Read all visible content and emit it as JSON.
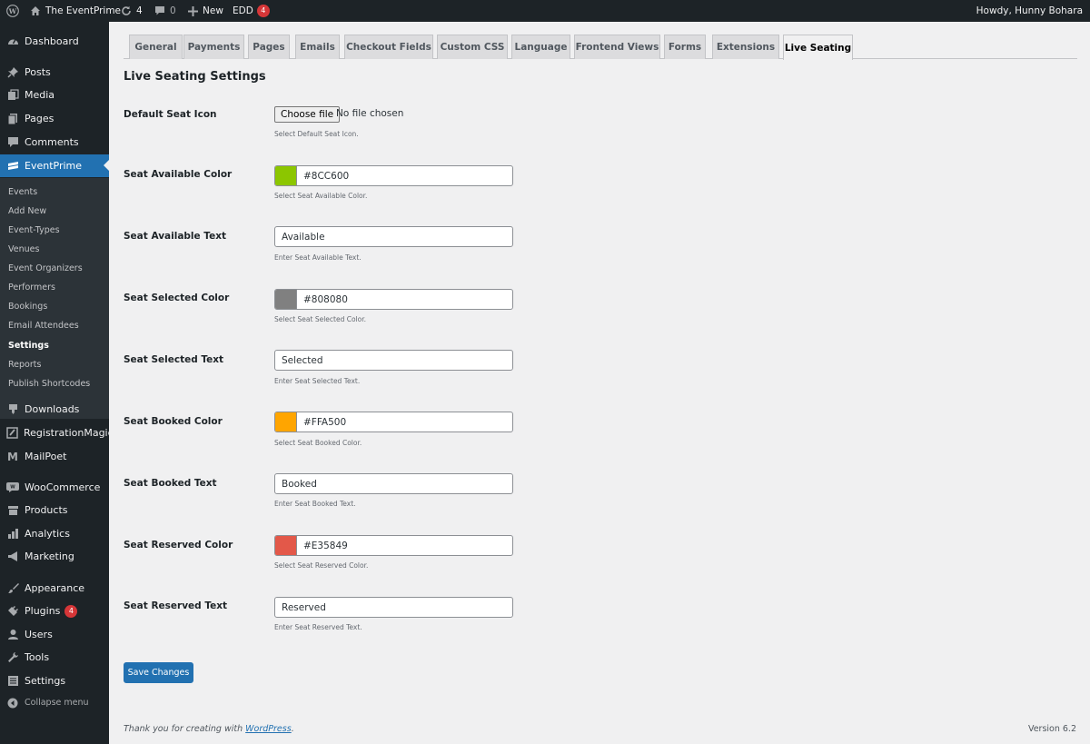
{
  "admin_bar": {
    "site_name": "The EventPrime",
    "updates_count": "4",
    "comments_count": "0",
    "new_label": "New",
    "edd_label": "EDD",
    "edd_badge": "4",
    "greeting": "Howdy, Hunny Bohara"
  },
  "sidebar": {
    "items": {
      "dashboard": "Dashboard",
      "posts": "Posts",
      "media": "Media",
      "pages": "Pages",
      "comments": "Comments",
      "eventprime": "EventPrime",
      "downloads": "Downloads",
      "registrationmagic": "RegistrationMagic",
      "mailpoet": "MailPoet",
      "woocommerce": "WooCommerce",
      "products": "Products",
      "analytics": "Analytics",
      "marketing": "Marketing",
      "appearance": "Appearance",
      "plugins": "Plugins",
      "plugins_badge": "4",
      "users": "Users",
      "tools": "Tools",
      "settings": "Settings",
      "collapse": "Collapse menu"
    },
    "submenu": [
      "Events",
      "Add New",
      "Event-Types",
      "Venues",
      "Event Organizers",
      "Performers",
      "Bookings",
      "Email Attendees",
      "Settings",
      "Reports",
      "Publish Shortcodes"
    ]
  },
  "tabs": [
    "General",
    "Payments",
    "Pages",
    "Emails",
    "Checkout Fields",
    "Custom CSS",
    "Language",
    "Frontend Views",
    "Forms",
    "Extensions",
    "Live Seating"
  ],
  "active_tab": "Live Seating",
  "form": {
    "heading": "Live Seating Settings",
    "default_icon": {
      "label": "Default Seat Icon",
      "button": "Choose file",
      "status": "No file chosen",
      "desc": "Select Default Seat Icon."
    },
    "available_color": {
      "label": "Seat Available Color",
      "value": "#8CC600",
      "color": "#8cc600",
      "desc": "Select Seat Available Color."
    },
    "available_text": {
      "label": "Seat Available Text",
      "value": "Available",
      "desc": "Enter Seat Available Text."
    },
    "selected_color": {
      "label": "Seat Selected Color",
      "value": "#808080",
      "color": "#808080",
      "desc": "Select Seat Selected Color."
    },
    "selected_text": {
      "label": "Seat Selected Text",
      "value": "Selected",
      "desc": "Enter Seat Selected Text."
    },
    "booked_color": {
      "label": "Seat Booked Color",
      "value": "#FFA500",
      "color": "#ffa500",
      "desc": "Select Seat Booked Color."
    },
    "booked_text": {
      "label": "Seat Booked Text",
      "value": "Booked",
      "desc": "Enter Seat Booked Text."
    },
    "reserved_color": {
      "label": "Seat Reserved Color",
      "value": "#E35849",
      "color": "#e35849",
      "desc": "Select Seat Reserved Color."
    },
    "reserved_text": {
      "label": "Seat Reserved Text",
      "value": "Reserved",
      "desc": "Enter Seat Reserved Text."
    },
    "save_label": "Save Changes"
  },
  "footer": {
    "thanks_prefix": "Thank you for creating with ",
    "wordpress_link": "WordPress",
    "thanks_suffix": ".",
    "version": "Version 6.2"
  },
  "colors": {
    "accent": "#2271b1",
    "admin_bar_bg": "#1d2327",
    "badge": "#d63638"
  }
}
